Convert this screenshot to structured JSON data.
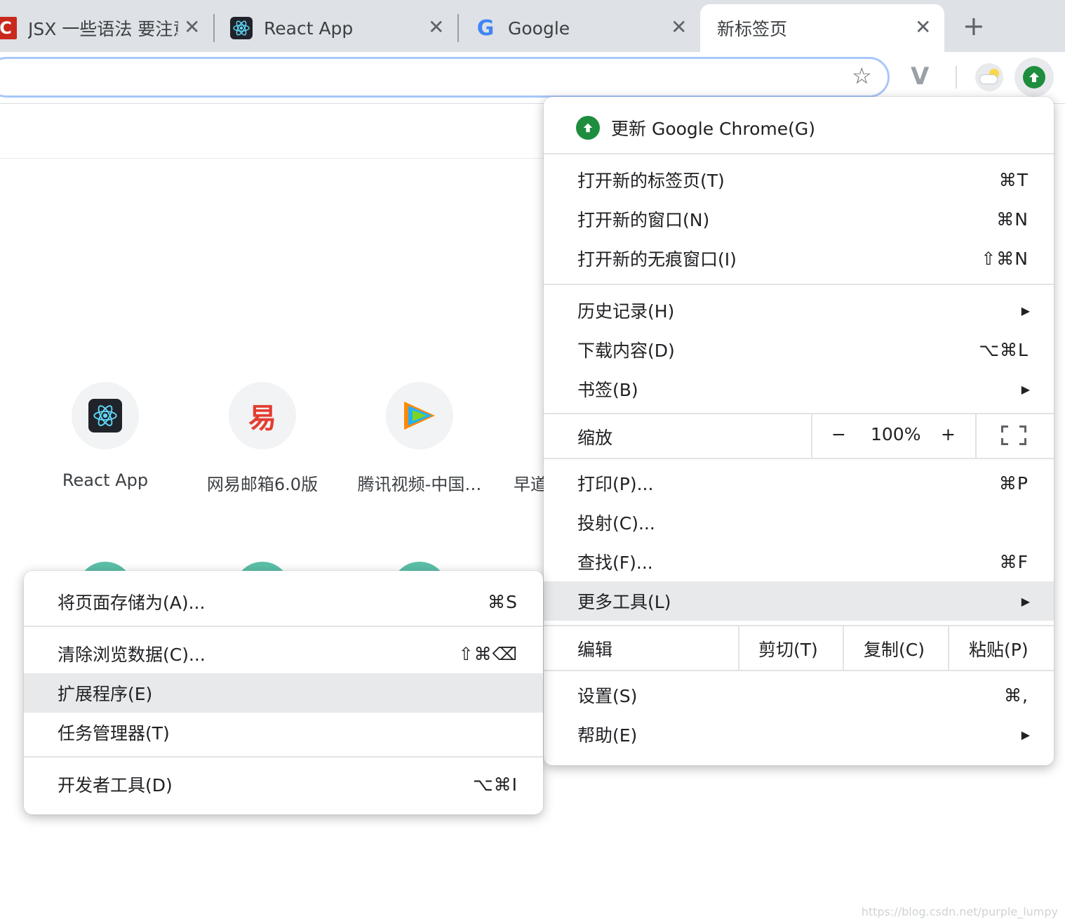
{
  "tabs": [
    {
      "title": "JSX 一些语法 要注意",
      "favicon": "csdn-icon",
      "favicon_text": "C"
    },
    {
      "title": "React App",
      "favicon": "react-icon"
    },
    {
      "title": "Google",
      "favicon": "google-icon",
      "favicon_text": "G"
    },
    {
      "title": "新标签页",
      "active": true
    }
  ],
  "tab_close_glyph": "✕",
  "new_tab_glyph": "+",
  "toolbar": {
    "star_glyph": "☆",
    "ext_v_glyph": "V"
  },
  "shortcuts": [
    {
      "label": "React App",
      "icon": "react-icon"
    },
    {
      "label": "网易邮箱6.0版",
      "icon": "netease-mail-icon",
      "icon_text": "易"
    },
    {
      "label": "腾讯视频-中国…",
      "icon": "tencent-video-icon"
    },
    {
      "label": "早道",
      "icon": ""
    }
  ],
  "menu": {
    "update": "更新 Google Chrome(G)",
    "new_tab": {
      "label": "打开新的标签页(T)",
      "shortcut": "⌘T"
    },
    "new_window": {
      "label": "打开新的窗口(N)",
      "shortcut": "⌘N"
    },
    "new_incognito": {
      "label": "打开新的无痕窗口(I)",
      "shortcut": "⇧⌘N"
    },
    "history": {
      "label": "历史记录(H)"
    },
    "downloads": {
      "label": "下载内容(D)",
      "shortcut": "⌥⌘L"
    },
    "bookmarks": {
      "label": "书签(B)"
    },
    "zoom": {
      "label": "缩放",
      "minus": "−",
      "value": "100%",
      "plus": "+"
    },
    "print": {
      "label": "打印(P)...",
      "shortcut": "⌘P"
    },
    "cast": {
      "label": "投射(C)..."
    },
    "find": {
      "label": "查找(F)...",
      "shortcut": "⌘F"
    },
    "more_tools": {
      "label": "更多工具(L)"
    },
    "edit": {
      "label": "编辑",
      "cut": "剪切(T)",
      "copy": "复制(C)",
      "paste": "粘贴(P)"
    },
    "settings": {
      "label": "设置(S)",
      "shortcut": "⌘,"
    },
    "help": {
      "label": "帮助(E)"
    },
    "arrow": "▶"
  },
  "submenu": {
    "save_as": {
      "label": "将页面存储为(A)...",
      "shortcut": "⌘S"
    },
    "clear_data": {
      "label": "清除浏览数据(C)...",
      "shortcut": "⇧⌘⌫"
    },
    "extensions": {
      "label": "扩展程序(E)"
    },
    "task_manager": {
      "label": "任务管理器(T)"
    },
    "dev_tools": {
      "label": "开发者工具(D)",
      "shortcut": "⌥⌘I"
    }
  },
  "watermark": "https://blog.csdn.net/purple_lumpy",
  "colors": {
    "accent_green": "#1e8e3e",
    "teal": "#5bbfa8",
    "highlight": "#e8e9eb"
  }
}
